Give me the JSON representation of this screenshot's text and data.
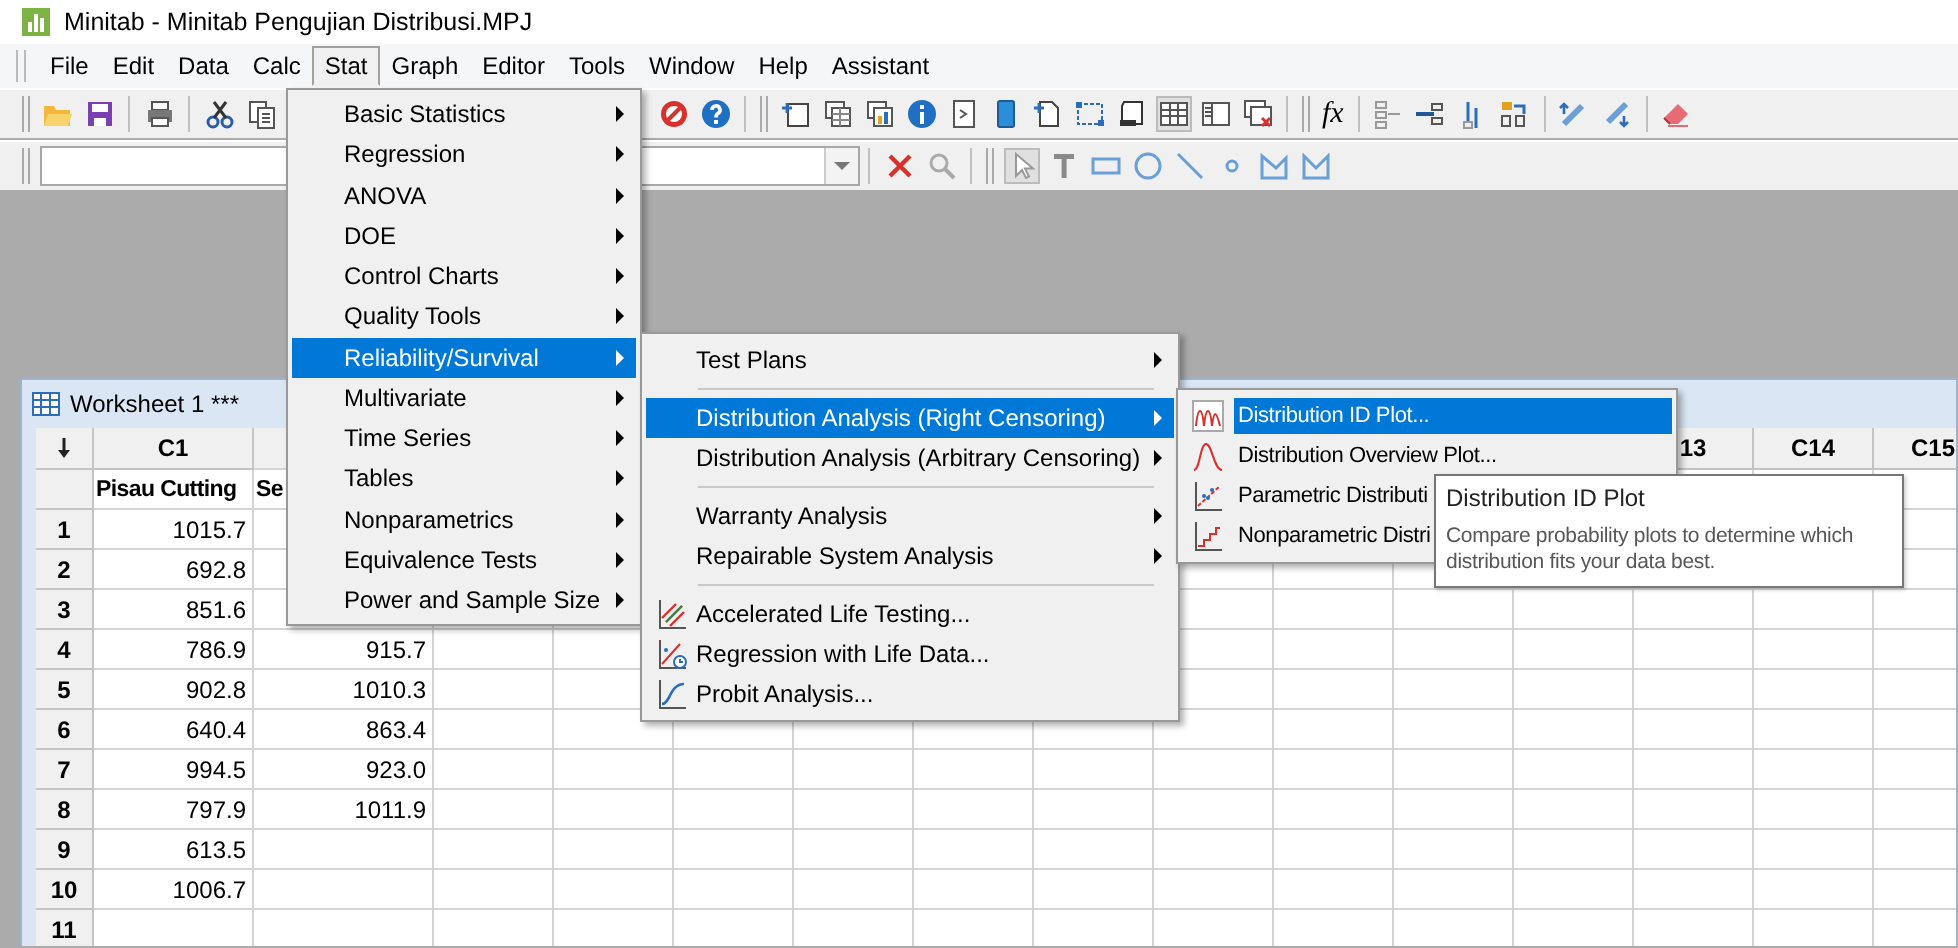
{
  "window": {
    "title": "Minitab - Minitab Pengujian Distribusi.MPJ"
  },
  "menu_bar": [
    {
      "label": "File",
      "selected": false
    },
    {
      "label": "Edit",
      "selected": false
    },
    {
      "label": "Data",
      "selected": false
    },
    {
      "label": "Calc",
      "selected": false
    },
    {
      "label": "Stat",
      "selected": true
    },
    {
      "label": "Graph",
      "selected": false
    },
    {
      "label": "Editor",
      "selected": false
    },
    {
      "label": "Tools",
      "selected": false
    },
    {
      "label": "Window",
      "selected": false
    },
    {
      "label": "Help",
      "selected": false
    },
    {
      "label": "Assistant",
      "selected": false
    }
  ],
  "toolbar": {
    "formula_label": "fx"
  },
  "stat_menu": [
    {
      "label": "Basic Statistics",
      "submenu": true,
      "selected": false
    },
    {
      "label": "Regression",
      "submenu": true,
      "selected": false
    },
    {
      "label": "ANOVA",
      "submenu": true,
      "selected": false
    },
    {
      "label": "DOE",
      "submenu": true,
      "selected": false
    },
    {
      "label": "Control Charts",
      "submenu": true,
      "selected": false
    },
    {
      "label": "Quality Tools",
      "submenu": true,
      "selected": false
    },
    {
      "label": "Reliability/Survival",
      "submenu": true,
      "selected": true
    },
    {
      "label": "Multivariate",
      "submenu": true,
      "selected": false
    },
    {
      "label": "Time Series",
      "submenu": true,
      "selected": false
    },
    {
      "label": "Tables",
      "submenu": true,
      "selected": false
    },
    {
      "label": "Nonparametrics",
      "submenu": true,
      "selected": false
    },
    {
      "label": "Equivalence Tests",
      "submenu": true,
      "selected": false
    },
    {
      "label": "Power and Sample Size",
      "submenu": true,
      "selected": false
    }
  ],
  "reliability_menu": [
    {
      "kind": "item",
      "label": "Test Plans",
      "submenu": true,
      "selected": false
    },
    {
      "kind": "separator"
    },
    {
      "kind": "item",
      "label": "Distribution Analysis (Right Censoring)",
      "submenu": true,
      "selected": true
    },
    {
      "kind": "item",
      "label": "Distribution Analysis (Arbitrary Censoring)",
      "submenu": true,
      "selected": false
    },
    {
      "kind": "separator"
    },
    {
      "kind": "item",
      "label": "Warranty Analysis",
      "submenu": true,
      "selected": false
    },
    {
      "kind": "item",
      "label": "Repairable System Analysis",
      "submenu": true,
      "selected": false
    },
    {
      "kind": "separator"
    },
    {
      "kind": "item",
      "label": "Accelerated Life Testing...",
      "submenu": false,
      "selected": false
    },
    {
      "kind": "item",
      "label": "Regression with Life Data...",
      "submenu": false,
      "selected": false
    },
    {
      "kind": "item",
      "label": "Probit Analysis...",
      "submenu": false,
      "selected": false
    }
  ],
  "distribution_menu": [
    {
      "label": "Distribution ID Plot...",
      "selected": true
    },
    {
      "label": "Distribution Overview Plot...",
      "selected": false
    },
    {
      "label": "Parametric Distributi",
      "selected": false
    },
    {
      "label": "Nonparametric Distri",
      "selected": false
    }
  ],
  "tooltip": {
    "title": "Distribution ID Plot",
    "text": "Compare probability plots to determine which distribution fits your data best."
  },
  "worksheet": {
    "title": "Worksheet 1 ***",
    "columns": [
      {
        "header": "C1",
        "name": "Pisau Cutting"
      },
      {
        "name": "Se"
      },
      {},
      {},
      {},
      {},
      {},
      {},
      {},
      {},
      {},
      {},
      {
        "header": "13"
      },
      {
        "header": "C14"
      },
      {
        "header": "C15"
      }
    ],
    "rows": [
      {
        "number": "1",
        "cells": [
          "1015.7"
        ]
      },
      {
        "number": "2",
        "cells": [
          "692.8"
        ]
      },
      {
        "number": "3",
        "cells": [
          "851.6"
        ]
      },
      {
        "number": "4",
        "cells": [
          "786.9",
          "915.7"
        ]
      },
      {
        "number": "5",
        "cells": [
          "902.8",
          "1010.3"
        ]
      },
      {
        "number": "6",
        "cells": [
          "640.4",
          "863.4"
        ]
      },
      {
        "number": "7",
        "cells": [
          "994.5",
          "923.0"
        ]
      },
      {
        "number": "8",
        "cells": [
          "797.9",
          "1011.9"
        ]
      },
      {
        "number": "9",
        "cells": [
          "613.5"
        ]
      },
      {
        "number": "10",
        "cells": [
          "1006.7"
        ]
      },
      {
        "number": "11"
      }
    ]
  }
}
